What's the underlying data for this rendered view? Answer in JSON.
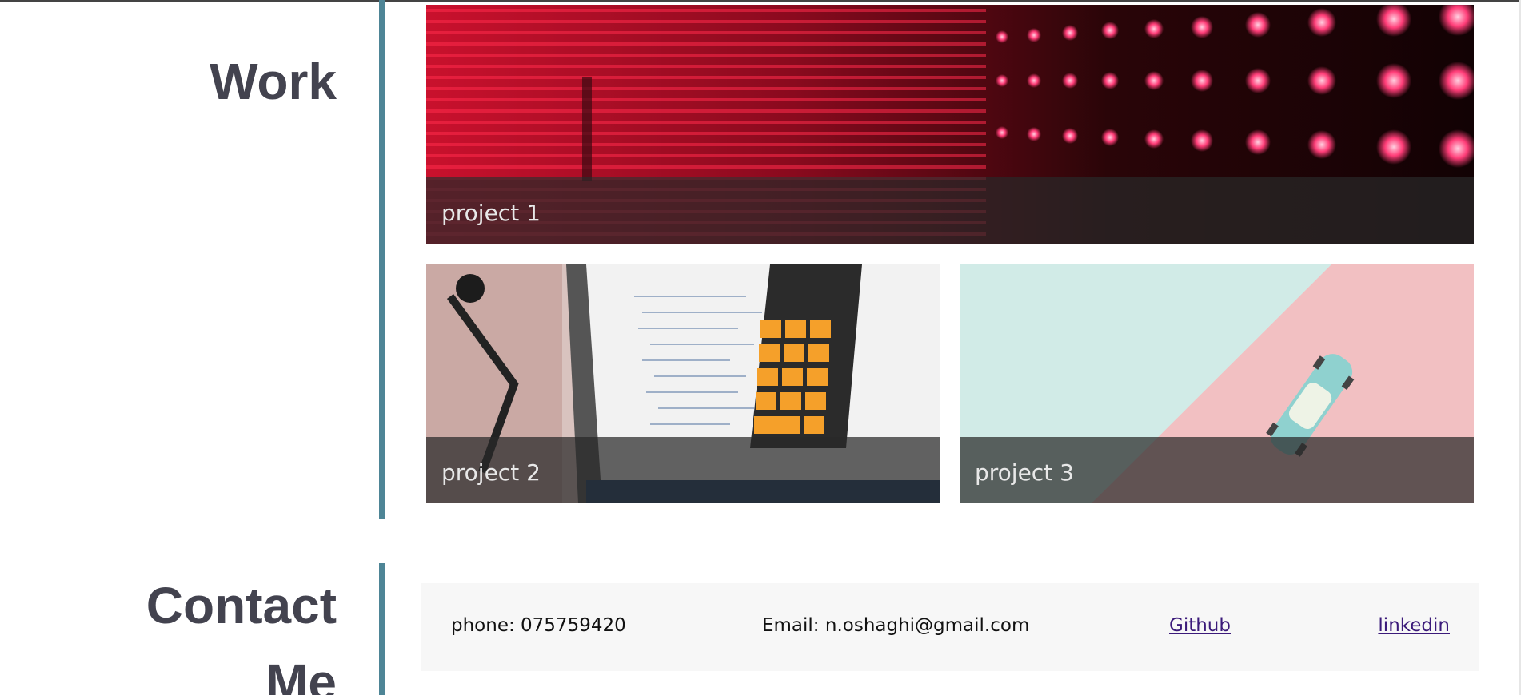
{
  "work": {
    "title": "Work",
    "projects": [
      {
        "caption": "project 1",
        "image": "red-led-wall"
      },
      {
        "caption": "project 2",
        "image": "laptop-calculator-code"
      },
      {
        "caption": "project 3",
        "image": "toy-car-mint-pink"
      }
    ]
  },
  "contact": {
    "title_line1": "Contact",
    "title_line2": "Me",
    "phone": "phone: 075759420",
    "email": "Email: n.oshaghi@gmail.com",
    "github": "Github",
    "linkedin": "linkedin"
  },
  "colors": {
    "heading": "#43434f",
    "accent_bar": "#4e8596",
    "caption_overlay": "rgba(40,40,40,0.72)",
    "link": "#3b1a7a",
    "contact_bg": "#f7f7f7"
  }
}
